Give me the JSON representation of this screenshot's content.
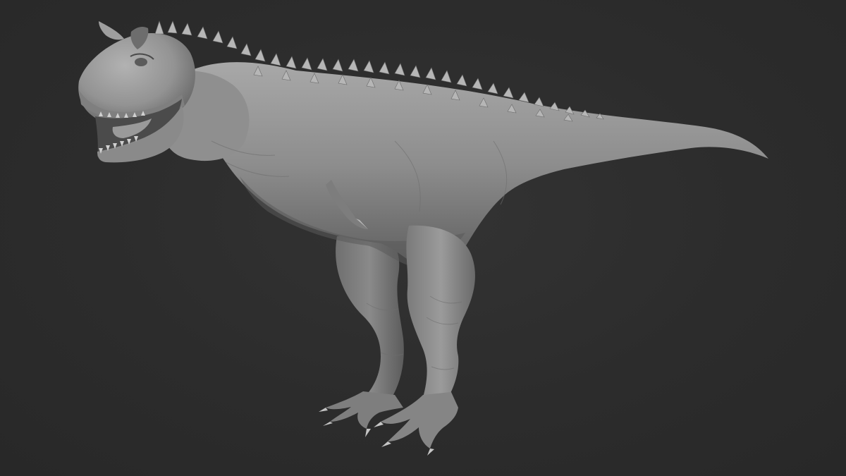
{
  "scene": {
    "subject": "carnotaurus-sculpt-model",
    "colors": {
      "background": "#2c2c2c",
      "clay_light": "#a9a9a9",
      "clay_mid": "#8c8c8c",
      "clay_dark": "#5e5e5e",
      "clay_shadow": "#474747",
      "spike": "#b5b5b5"
    }
  }
}
